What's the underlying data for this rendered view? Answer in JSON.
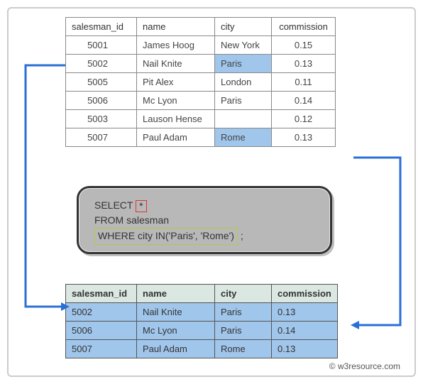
{
  "source": {
    "headers": [
      "salesman_id",
      "name",
      "city",
      "commission"
    ],
    "rows": [
      {
        "id": "5001",
        "name": "James Hoog",
        "city": "New York",
        "commission": "0.15",
        "highlight": false
      },
      {
        "id": "5002",
        "name": "Nail Knite",
        "city": "Paris",
        "commission": "0.13",
        "highlight": true
      },
      {
        "id": "5005",
        "name": "Pit Alex",
        "city": "London",
        "commission": "0.11",
        "highlight": false
      },
      {
        "id": "5006",
        "name": "Mc Lyon",
        "city": "Paris",
        "commission": "0.14",
        "highlight": false
      },
      {
        "id": "5003",
        "name": "Lauson Hense",
        "city": "",
        "commission": "0.12",
        "highlight": false
      },
      {
        "id": "5007",
        "name": "Paul Adam",
        "city": "Rome",
        "commission": "0.13",
        "highlight": true
      }
    ]
  },
  "query": {
    "select_kw": "SELECT",
    "star": "*",
    "from_line": "FROM salesman",
    "where_clause": "WHERE city IN('Paris', 'Rome')",
    "terminator": ";"
  },
  "result": {
    "headers": [
      "salesman_id",
      "name",
      "city",
      "commission"
    ],
    "rows": [
      {
        "id": "5002",
        "name": "Nail Knite",
        "city": "Paris",
        "commission": "0.13"
      },
      {
        "id": "5006",
        "name": "Mc Lyon",
        "city": "Paris",
        "commission": "0.14"
      },
      {
        "id": "5007",
        "name": "Paul Adam",
        "city": "Rome",
        "commission": "0.13"
      }
    ]
  },
  "credit": "© w3resource.com"
}
